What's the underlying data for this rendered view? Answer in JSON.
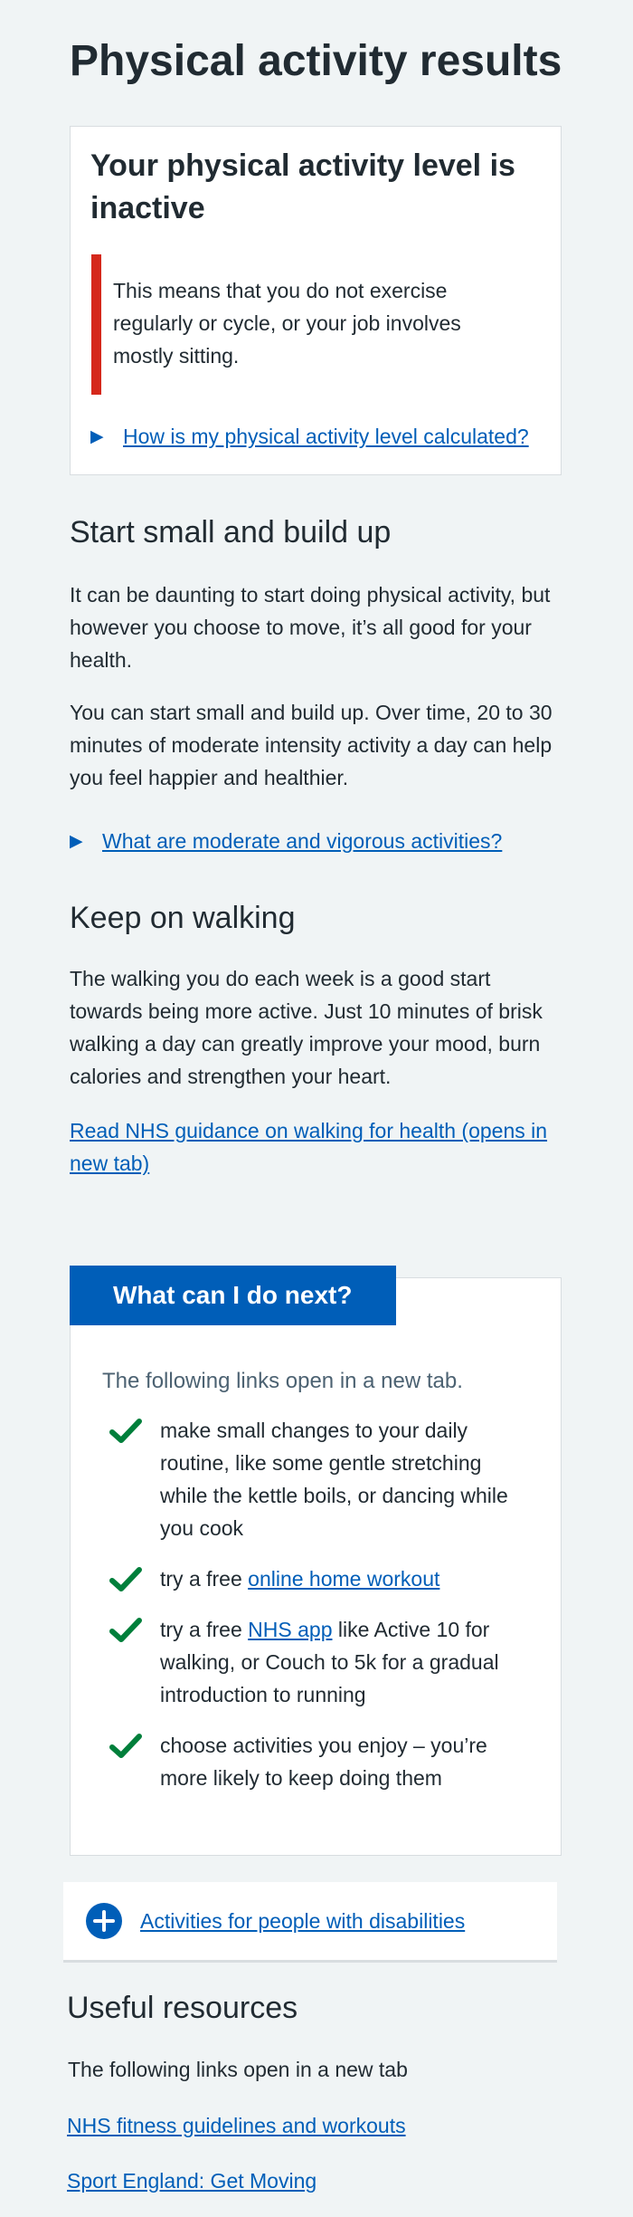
{
  "page": {
    "title": "Physical activity results"
  },
  "result": {
    "heading": "Your physical activity level is inactive",
    "inset": "This means that you do not exercise regularly or cycle, or your job involves mostly sitting.",
    "details_label": "How is my physical activity level calculated?",
    "inset_color": "#d5281b"
  },
  "start_small": {
    "heading": "Start small and build up",
    "para1": "It can be daunting to start doing physical activity, but however you choose to move, it’s all good for your health.",
    "para2": "You can start small and build up. Over time, 20 to 30 minutes of moderate intensity activity a day can help you feel happier and healthier.",
    "details_label": "What are moderate and vigorous activities?"
  },
  "walking": {
    "heading": "Keep on walking",
    "para": "The walking you do each week is a good start towards being more active. Just 10 minutes of brisk walking a day can greatly improve your mood, burn calories and strengthen your heart.",
    "link": "Read NHS guidance on walking for health (opens in new tab)"
  },
  "next": {
    "label": "What can I do next?",
    "intro": "The following links open in a new tab.",
    "items": [
      {
        "text": "make small changes to your daily routine, like some gentle stretching while the kettle boils, or dancing while you cook"
      },
      {
        "before": "try a free ",
        "link": "online home workout",
        "after": ""
      },
      {
        "before": "try a free ",
        "link": "NHS app",
        "after": " like Active 10 for walking, or Couch to 5k for a gradual introduction to running"
      },
      {
        "text": "choose activities you enjoy – you’re more likely to keep doing them"
      }
    ],
    "accent_color": "#005eb8",
    "tick_color": "#007f3b",
    "tick_icon": "check-icon"
  },
  "disabilities": {
    "label": "Activities for people with disabilities",
    "icon": "plus-circle-icon"
  },
  "resources": {
    "heading": "Useful resources",
    "intro": "The following links open in a new tab",
    "links": [
      "NHS fitness guidelines and workouts",
      "Sport England: Get Moving"
    ]
  }
}
